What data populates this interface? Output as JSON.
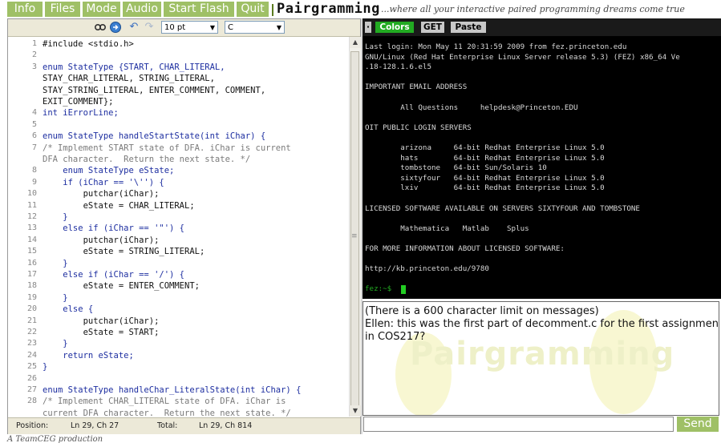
{
  "menu": {
    "items": [
      "Info",
      "Files",
      "Mode",
      "Audio",
      "Start Flash",
      "Quit"
    ],
    "title": "Pairgramming",
    "tagline": "...where all your interactive paired programming dreams come true"
  },
  "editor": {
    "font_size": "10 pt",
    "language": "C",
    "code": [
      {
        "ln": "1",
        "t": "#include <stdio.h>"
      },
      {
        "ln": "2",
        "t": ""
      },
      {
        "ln": "3",
        "t": "enum StateType {START, CHAR_LITERAL,"
      },
      {
        "ln": "",
        "t": "STAY_CHAR_LITERAL, STRING_LITERAL,"
      },
      {
        "ln": "",
        "t": "STAY_STRING_LITERAL, ENTER_COMMENT, COMMENT,"
      },
      {
        "ln": "",
        "t": "EXIT_COMMENT};"
      },
      {
        "ln": "4",
        "t": "int iErrorLine;"
      },
      {
        "ln": "5",
        "t": ""
      },
      {
        "ln": "6",
        "t": "enum StateType handleStartState(int iChar) {"
      },
      {
        "ln": "7",
        "t": "/* Implement START state of DFA. iChar is current"
      },
      {
        "ln": "",
        "t": "DFA character.  Return the next state. */"
      },
      {
        "ln": "8",
        "t": "    enum StateType eState;"
      },
      {
        "ln": "9",
        "t": "    if (iChar == '\\'') {"
      },
      {
        "ln": "10",
        "t": "        putchar(iChar);"
      },
      {
        "ln": "11",
        "t": "        eState = CHAR_LITERAL;"
      },
      {
        "ln": "12",
        "t": "    }"
      },
      {
        "ln": "13",
        "t": "    else if (iChar == '\"') {"
      },
      {
        "ln": "14",
        "t": "        putchar(iChar);"
      },
      {
        "ln": "15",
        "t": "        eState = STRING_LITERAL;"
      },
      {
        "ln": "16",
        "t": "    }"
      },
      {
        "ln": "17",
        "t": "    else if (iChar == '/') {"
      },
      {
        "ln": "18",
        "t": "        eState = ENTER_COMMENT;"
      },
      {
        "ln": "19",
        "t": "    }"
      },
      {
        "ln": "20",
        "t": "    else {"
      },
      {
        "ln": "21",
        "t": "        putchar(iChar);"
      },
      {
        "ln": "22",
        "t": "        eState = START;"
      },
      {
        "ln": "23",
        "t": "    }"
      },
      {
        "ln": "24",
        "t": "    return eState;"
      },
      {
        "ln": "25",
        "t": "}"
      },
      {
        "ln": "26",
        "t": ""
      },
      {
        "ln": "27",
        "t": "enum StateType handleChar_LiteralState(int iChar) {"
      },
      {
        "ln": "28",
        "t": "/* Implement CHAR_LITERAL state of DFA. iChar is"
      },
      {
        "ln": "",
        "t": "current DFA character.  Return the next state. */"
      }
    ],
    "status": {
      "position_label": "Position:",
      "position_value": "Ln 29, Ch 27",
      "total_label": "Total:",
      "total_value": "Ln 29, Ch 814"
    }
  },
  "terminal": {
    "buttons": {
      "colors": "Colors",
      "get": "GET",
      "paste": "Paste"
    },
    "lines": [
      "Last login: Mon May 11 20:31:59 2009 from fez.princeton.edu",
      "GNU/Linux (Red Hat Enterprise Linux Server release 5.3) (FEZ) x86_64 Ve",
      ".18-128.1.6.el5",
      "",
      "IMPORTANT EMAIL ADDRESS",
      "",
      "        All Questions     helpdesk@Princeton.EDU",
      "",
      "OIT PUBLIC LOGIN SERVERS",
      "",
      "        arizona     64-bit Redhat Enterprise Linux 5.0",
      "        hats        64-bit Redhat Enterprise Linux 5.0",
      "        tombstone   64-bit Sun/Solaris 10",
      "        sixtyfour   64-bit Redhat Enterprise Linux 5.0",
      "        lxiv        64-bit Redhat Enterprise Linux 5.0",
      "",
      "LICENSED SOFTWARE AVAILABLE ON SERVERS SIXTYFOUR AND TOMBSTONE",
      "",
      "        Mathematica   Matlab    Splus",
      "",
      "FOR MORE INFORMATION ABOUT LICENSED SOFTWARE:",
      "",
      "http://kb.princeton.edu/9780",
      "",
      "fez:~$"
    ]
  },
  "chat": {
    "lines": [
      "(There is a 600 character limit on messages)",
      "Ellen: this was the first part of decomment.c for the first assignment",
      "in COS217?"
    ],
    "watermark": "Pairgramming",
    "input_value": "",
    "send_label": "Send"
  },
  "footer": "A TeamCEG production",
  "colors": {
    "menu_green": "#9fc066",
    "term_green": "#22aa22",
    "kw_blue": "#1d2ea0"
  }
}
